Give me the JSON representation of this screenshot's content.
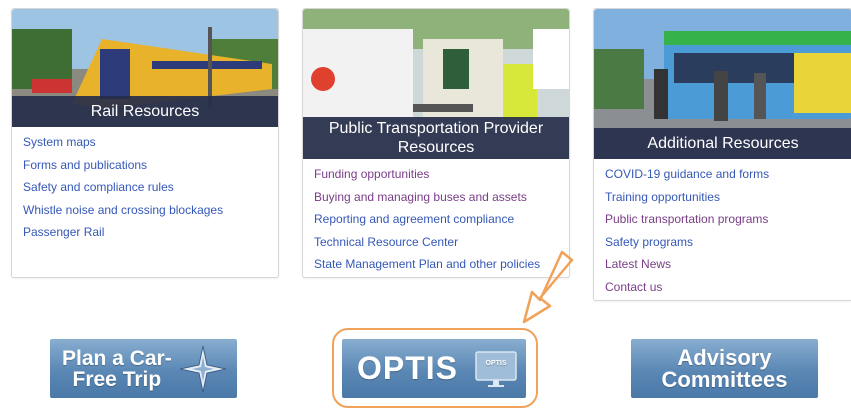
{
  "cards": [
    {
      "title": "Rail Resources",
      "links": [
        "System maps",
        "Forms and publications",
        "Safety and compliance rules",
        "Whistle noise and crossing blockages",
        "Passenger Rail"
      ]
    },
    {
      "title": "Public Transportation Provider Resources",
      "links": [
        "Funding opportunities",
        "Buying and managing buses and assets",
        "Reporting and agreement compliance",
        "Technical Resource Center",
        "State Management Plan and other policies"
      ]
    },
    {
      "title": "Additional Resources",
      "links": [
        "COVID-19 guidance and forms",
        "Training opportunities",
        "Public transportation programs",
        "Safety programs",
        "Latest News",
        "Contact us"
      ]
    }
  ],
  "banners": {
    "plan_line1": "Plan a Car-",
    "plan_line2": "Free Trip",
    "optis": "OPTIS",
    "optis_icon_label": "OPTIS",
    "advisory_line1": "Advisory",
    "advisory_line2": "Committees"
  },
  "colors": {
    "link": "#3558b8",
    "visited_link": "#7a3d88",
    "title_bar": "#262e4a",
    "banner": "#5a87b4",
    "highlight": "#f0a25a"
  }
}
